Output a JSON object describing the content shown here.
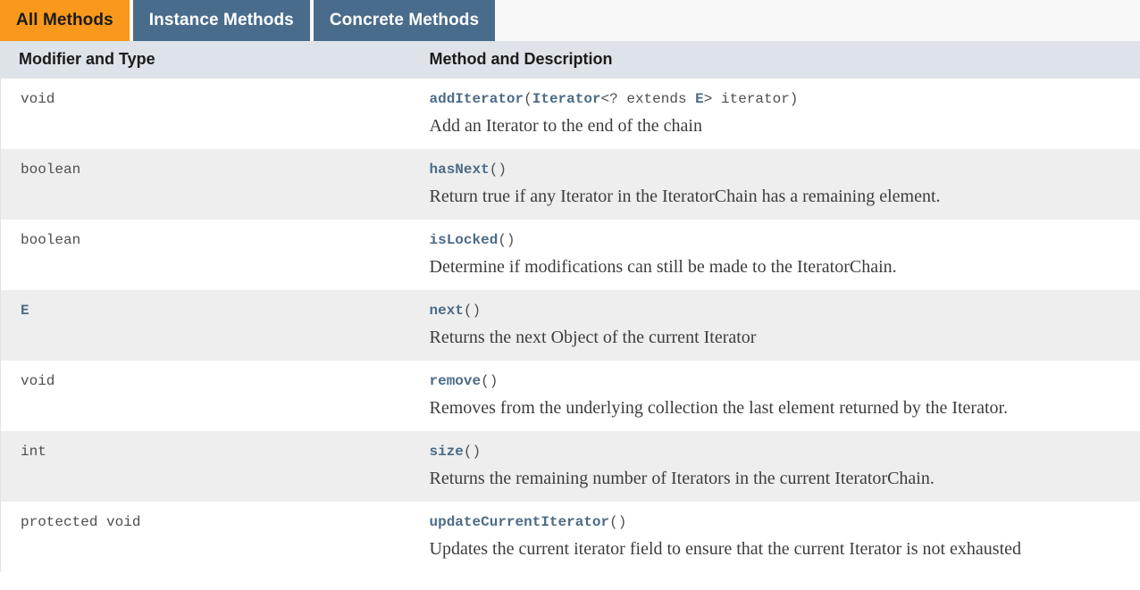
{
  "tabs": [
    {
      "label": "All Methods",
      "state": "active"
    },
    {
      "label": "Instance Methods",
      "state": "inactive"
    },
    {
      "label": "Concrete Methods",
      "state": "inactive"
    }
  ],
  "table": {
    "headers": {
      "modifier_and_type": "Modifier and Type",
      "method_and_description": "Method and Description"
    },
    "rows": [
      {
        "modifier": "void",
        "modifier_is_link": false,
        "method_name": "addIterator",
        "signature_parts": [
          {
            "text": "(",
            "kind": "plain"
          },
          {
            "text": "Iterator",
            "kind": "link"
          },
          {
            "text": "<? extends ",
            "kind": "plain"
          },
          {
            "text": "E",
            "kind": "link"
          },
          {
            "text": ">",
            "kind": "plain"
          },
          {
            "text": "  iterator)",
            "kind": "plain"
          }
        ],
        "description": "Add an Iterator to the end of the chain",
        "shade": "norm"
      },
      {
        "modifier": "boolean",
        "modifier_is_link": false,
        "method_name": "hasNext",
        "signature_parts": [
          {
            "text": "()",
            "kind": "plain"
          }
        ],
        "description": "Return true if any Iterator in the IteratorChain has a remaining element.",
        "shade": "alt"
      },
      {
        "modifier": "boolean",
        "modifier_is_link": false,
        "method_name": "isLocked",
        "signature_parts": [
          {
            "text": "()",
            "kind": "plain"
          }
        ],
        "description": "Determine if modifications can still be made to the IteratorChain.",
        "shade": "norm"
      },
      {
        "modifier": "E",
        "modifier_is_link": true,
        "method_name": "next",
        "signature_parts": [
          {
            "text": "()",
            "kind": "plain"
          }
        ],
        "description": "Returns the next Object of the current Iterator",
        "shade": "alt"
      },
      {
        "modifier": "void",
        "modifier_is_link": false,
        "method_name": "remove",
        "signature_parts": [
          {
            "text": "()",
            "kind": "plain"
          }
        ],
        "description": "Removes from the underlying collection the last element returned by the Iterator.",
        "shade": "norm"
      },
      {
        "modifier": "int",
        "modifier_is_link": false,
        "method_name": "size",
        "signature_parts": [
          {
            "text": "()",
            "kind": "plain"
          }
        ],
        "description": "Returns the remaining number of Iterators in the current IteratorChain.",
        "shade": "alt"
      },
      {
        "modifier": "protected void",
        "modifier_is_link": false,
        "method_name": "updateCurrentIterator",
        "signature_parts": [
          {
            "text": "()",
            "kind": "plain"
          }
        ],
        "description": "Updates the current iterator field to ensure that the current Iterator is not exhausted",
        "shade": "norm"
      }
    ]
  },
  "colors": {
    "tab_active_bg": "#f8981d",
    "tab_inactive_bg": "#4a6c8c",
    "header_bg": "#dee3e9",
    "row_alt_bg": "#eeeeee",
    "row_norm_bg": "#ffffff",
    "link": "#4c6b87",
    "strip_bg": "#f8f8f8"
  }
}
